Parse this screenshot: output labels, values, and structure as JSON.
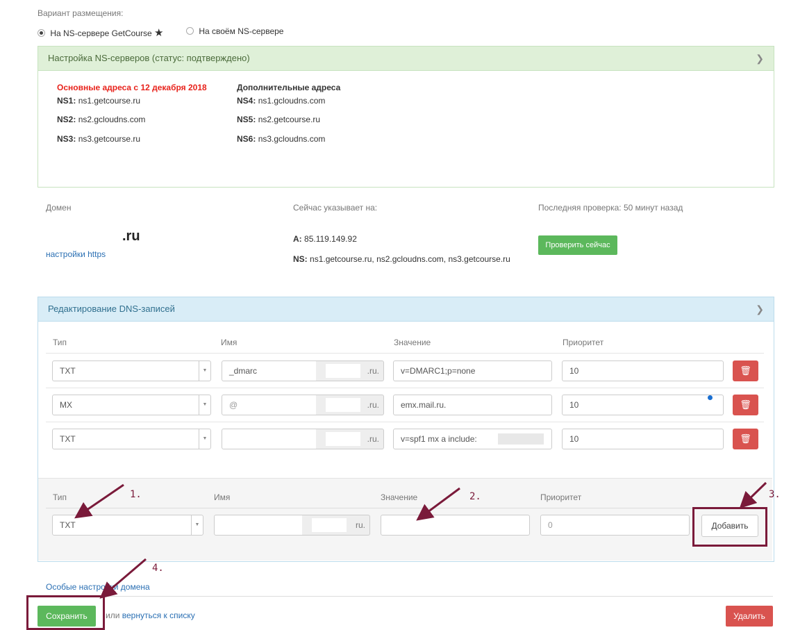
{
  "placement": {
    "label": "Вариант размещения:",
    "options": [
      {
        "label": "На NS-сервере GetCourse",
        "star": "★",
        "selected": true
      },
      {
        "label": "На своём NS-сервере",
        "selected": false
      }
    ]
  },
  "ns_panel": {
    "title": "Настройка NS-серверов (статус: подтверждено)",
    "main_heading": "Основные адреса с 12 декабря 2018",
    "extra_heading": "Дополнительные адреса",
    "main": [
      {
        "key": "NS1:",
        "value": "ns1.getcourse.ru"
      },
      {
        "key": "NS2:",
        "value": "ns2.gcloudns.com"
      },
      {
        "key": "NS3:",
        "value": "ns3.getcourse.ru"
      }
    ],
    "extra": [
      {
        "key": "NS4:",
        "value": "ns1.gcloudns.com"
      },
      {
        "key": "NS5:",
        "value": "ns2.getcourse.ru"
      },
      {
        "key": "NS6:",
        "value": "ns3.gcloudns.com"
      }
    ]
  },
  "domain": {
    "label": "Домен",
    "name": ".ru",
    "https_link": "настройки https",
    "points_label": "Сейчас указывает на:",
    "a_key": "A:",
    "a_value": "85.119.149.92",
    "ns_key": "NS:",
    "ns_value": "ns1.getcourse.ru, ns2.gcloudns.com, ns3.getcourse.ru",
    "last_check": "Последняя проверка: 50 минут назад",
    "check_now": "Проверить сейчас"
  },
  "dns_panel": {
    "title": "Редактирование DNS-записей",
    "headers": {
      "type": "Тип",
      "name": "Имя",
      "value": "Значение",
      "priority": "Приоритет"
    },
    "rows": [
      {
        "type": "TXT",
        "name": "_dmarc",
        "suffix": ".ru.",
        "value": "v=DMARC1;p=none",
        "priority": "10"
      },
      {
        "type": "MX",
        "name": "@",
        "suffix": ".ru.",
        "value": "emx.mail.ru.",
        "priority": "10"
      },
      {
        "type": "TXT",
        "name": "",
        "suffix": ".ru.",
        "value": "v=spf1 mx a include:",
        "priority": "10"
      }
    ],
    "trash_icon": "trash-icon",
    "new_record": {
      "headers": {
        "type": "Тип",
        "name": "Имя",
        "value": "Значение",
        "priority": "Приоритет"
      },
      "type": "TXT",
      "suffix": "ru.",
      "priority": "0",
      "add_button": "Добавить"
    }
  },
  "annotations": {
    "a1": "1.",
    "a2": "2.",
    "a3": "3.",
    "a4": "4.",
    "color": "#7a1a3a"
  },
  "footer": {
    "special_link": "Особые настройки домена",
    "save": "Сохранить",
    "or_text": "или",
    "back_link": "вернуться к списку",
    "delete": "Удалить"
  }
}
